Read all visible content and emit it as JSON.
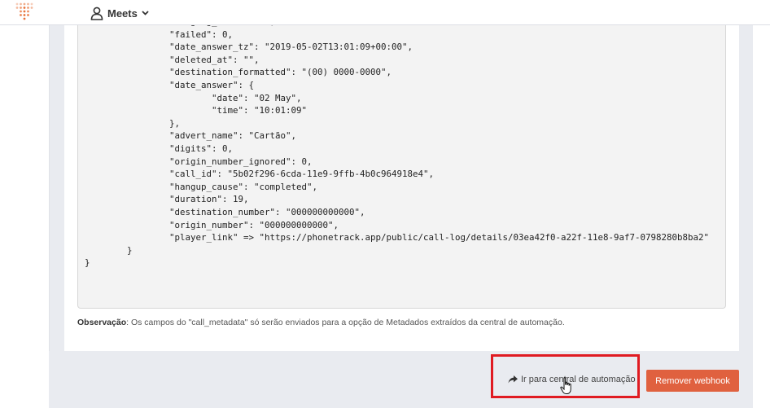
{
  "header": {
    "user_menu_label": "Meets",
    "icons": {
      "logo": "phonetrack-dot-logo",
      "user": "user-icon",
      "dropdown": "chevron-down-icon"
    }
  },
  "webhook_sample": {
    "code_lines": [
      "                \"ringing_t...\": ...,",
      "                \"failed\": 0,",
      "                \"date_answer_tz\": \"2019-05-02T13:01:09+00:00\",",
      "                \"deleted_at\": \"\",",
      "                \"destination_formatted\": \"(00) 0000-0000\",",
      "                \"date_answer\": {",
      "                        \"date\": \"02 May\",",
      "                        \"time\": \"10:01:09\"",
      "                },",
      "                \"advert_name\": \"Cartão\",",
      "                \"digits\": 0,",
      "                \"origin_number_ignored\": 0,",
      "                \"call_id\": \"5b02f296-6cda-11e9-9ffb-4b0c964918e4\",",
      "                \"hangup_cause\": \"completed\",",
      "                \"duration\": 19,",
      "                \"destination_number\": \"000000000000\",",
      "                \"origin_number\": \"000000000000\",",
      "                \"player_link\" => \"https://phonetrack.app/public/call-log/details/03ea42f0-a22f-11e8-9af7-0798280b8ba2\"",
      "        }",
      "}"
    ]
  },
  "note": {
    "label": "Observação",
    "text": ": Os campos do \"call_metadata\" só serão enviados para a opção de Metadados extraídos da central de automação."
  },
  "actions": {
    "go_automation_label": "Ir para central de automação",
    "remove_webhook_label": "Remover webhook",
    "icons": {
      "share": "share-arrow-icon"
    }
  },
  "colors": {
    "accent_orange": "#e0613f",
    "highlight_red": "#e01b22",
    "background": "#e9ebf0"
  }
}
